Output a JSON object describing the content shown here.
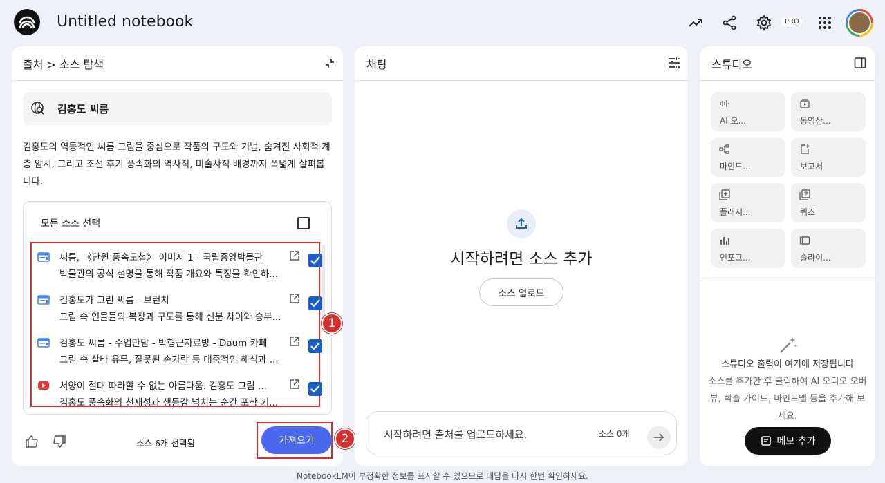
{
  "header": {
    "title": "Untitled notebook",
    "pro_badge": "PRO"
  },
  "left": {
    "breadcrumb": "출처 > 소스 탐색",
    "query": "김홍도 씨름",
    "description": "김홍도의 역동적인 씨름 그림을 중심으로 작품의 구도와 기법, 숨겨진 사회적 계층 암시, 그리고 조선 후기 풍속화의 역사적, 미술사적 배경까지 폭넓게 살펴봅니다.",
    "select_all": "모든 소스 선택",
    "sources": [
      {
        "type": "web",
        "title": "씨름, 《단원 풍속도첩》 이미지 1 - 국립중앙박물관",
        "subtitle": "박물관의 공식 설명을 통해 작품 개요와 특징을 확인하...",
        "checked": true
      },
      {
        "type": "web",
        "title": "김홍도가 그린 씨름 - 브런치",
        "subtitle": "그림 속 인물들의 복장과 구도를 통해 신분 차이와 승부...",
        "checked": true
      },
      {
        "type": "web",
        "title": "김홍도 씨름 - 수업만담 - 박형근자료방 - Daum 카페",
        "subtitle": "그림 속 샅바 유무, 잘못된 손가락 등 대중적인 해석과 ...",
        "checked": true
      },
      {
        "type": "youtube",
        "title": "서양이 절대 따라할 수 없는 아름다움. 김홍도 그림 ...",
        "subtitle": "김홍도 풍속화의 천재성과 생동감 넘치는 순간 포착 기...",
        "checked": true
      }
    ],
    "annotation_1": "1",
    "annotation_2": "2",
    "selected_count": "소스 6개 선택됨",
    "import_label": "가져오기"
  },
  "chat": {
    "title": "채팅",
    "empty_title": "시작하려면 소스 추가",
    "upload_label": "소스 업로드",
    "input_placeholder": "시작하려면 출처를 업로드하세요.",
    "source_count": "소스 0개"
  },
  "studio": {
    "title": "스튜디오",
    "tiles": [
      {
        "label": "AI 오...",
        "icon": "audio-icon"
      },
      {
        "label": "동영상...",
        "icon": "video-icon"
      },
      {
        "label": "마인드...",
        "icon": "mindmap-icon"
      },
      {
        "label": "보고서",
        "icon": "report-icon"
      },
      {
        "label": "플래시...",
        "icon": "flashcard-icon"
      },
      {
        "label": "퀴즈",
        "icon": "quiz-icon"
      },
      {
        "label": "인포그...",
        "icon": "infographic-icon"
      },
      {
        "label": "슬라이...",
        "icon": "slides-icon"
      }
    ],
    "empty_heading": "스튜디오 출력이 여기에 저장됩니다",
    "empty_body": "소스를 추가한 후 클릭하여 AI 오디오 오버뷰, 학습 가이드, 마인드맵 등을 추가해 보세요.",
    "memo_label": "메모 추가"
  },
  "disclaimer": "NotebookLM이 부정확한 정보를 표시할 수 있으므로 대답을 다시 한번 확인하세요.",
  "colors": {
    "background": "#eef1f8",
    "accent_blue": "#4a67f0",
    "checkbox_blue": "#1a5fc8",
    "annotation_red": "#d32f2f",
    "youtube_red": "#e53935",
    "web_icon_blue": "#4285f4"
  }
}
